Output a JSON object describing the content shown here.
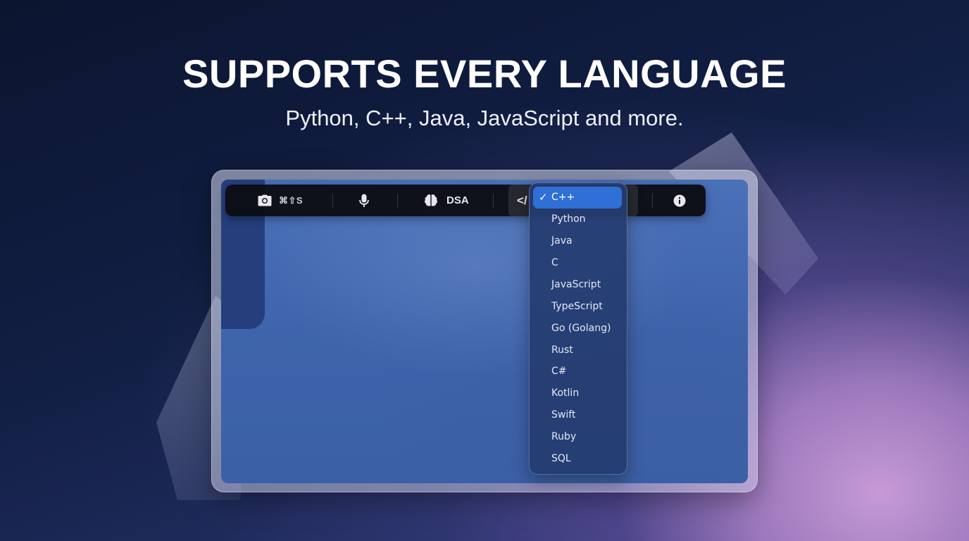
{
  "hero": {
    "title": "SUPPORTS EVERY LANGUAGE",
    "subtitle": "Python, C++, Java, JavaScript and more."
  },
  "toolbar": {
    "screenshot_shortcut": "⌘⇧S",
    "dsa_label": "DSA",
    "code_icon_glyph": "</",
    "icons": [
      "camera-icon",
      "microphone-icon",
      "brain-icon",
      "code-icon",
      "info-icon"
    ]
  },
  "language_dropdown": {
    "selected": "C++",
    "check_glyph": "✓",
    "items": [
      "Python",
      "Java",
      "C",
      "JavaScript",
      "TypeScript",
      "Go (Golang)",
      "Rust",
      "C#",
      "Kotlin",
      "Swift",
      "Ruby",
      "SQL"
    ]
  },
  "colors": {
    "selected_item": "#2f6fd6",
    "toolbar_bg": "#0c0e14",
    "screen_bg": "#4a70b8"
  }
}
